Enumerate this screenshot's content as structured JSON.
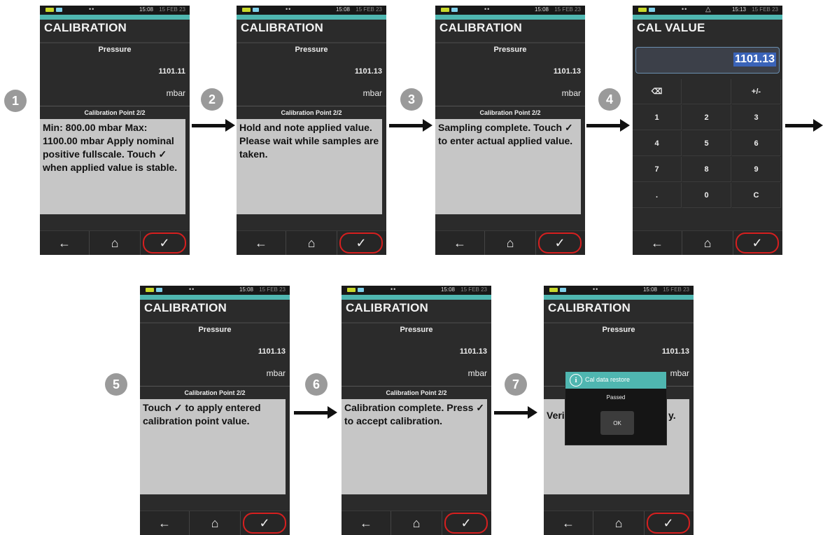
{
  "status": {
    "time_a": "15:08",
    "time_b": "15:13",
    "date": "15 FEB 23"
  },
  "screen": {
    "title": "CALIBRATION",
    "pressure_label": "Pressure",
    "unit": "mbar",
    "cal_point": "Calibration Point 2/2"
  },
  "nav": {
    "back": "←",
    "home": "⌂",
    "ok": "✓"
  },
  "steps": [
    {
      "number": "1",
      "value": "1101.11",
      "message": "Min: 800.00 mbar Max: 1100.00 mbar Apply nominal positive fullscale. Touch ✓ when applied value is stable."
    },
    {
      "number": "2",
      "value": "1101.13",
      "message": "Hold and note applied value. Please wait while samples are taken."
    },
    {
      "number": "3",
      "value": "1101.13",
      "message": "Sampling complete. Touch ✓ to enter actual applied value."
    },
    {
      "number": "4",
      "title": "CAL VALUE",
      "entry": "1101.13",
      "keys": [
        "⌫",
        "",
        "+/-",
        "1",
        "2",
        "3",
        "4",
        "5",
        "6",
        "7",
        "8",
        "9",
        ".",
        "0",
        "C"
      ]
    },
    {
      "number": "5",
      "value": "1101.13",
      "message": "Touch ✓ to apply entered calibration point value."
    },
    {
      "number": "6",
      "value": "1101.13",
      "message": "Calibration complete. Press ✓ to accept calibration."
    },
    {
      "number": "7",
      "value": "1101.13",
      "message_left": "Veri",
      "message_right": "y.",
      "dialog": {
        "title": "Cal data restore",
        "body": "Passed",
        "ok": "OK",
        "icon": "info-icon"
      }
    }
  ],
  "colors": {
    "teal": "#4fb6b0",
    "ok_ring": "#d61f1f",
    "message_bg": "#c6c6c6",
    "device_bg": "#2b2b2b"
  }
}
